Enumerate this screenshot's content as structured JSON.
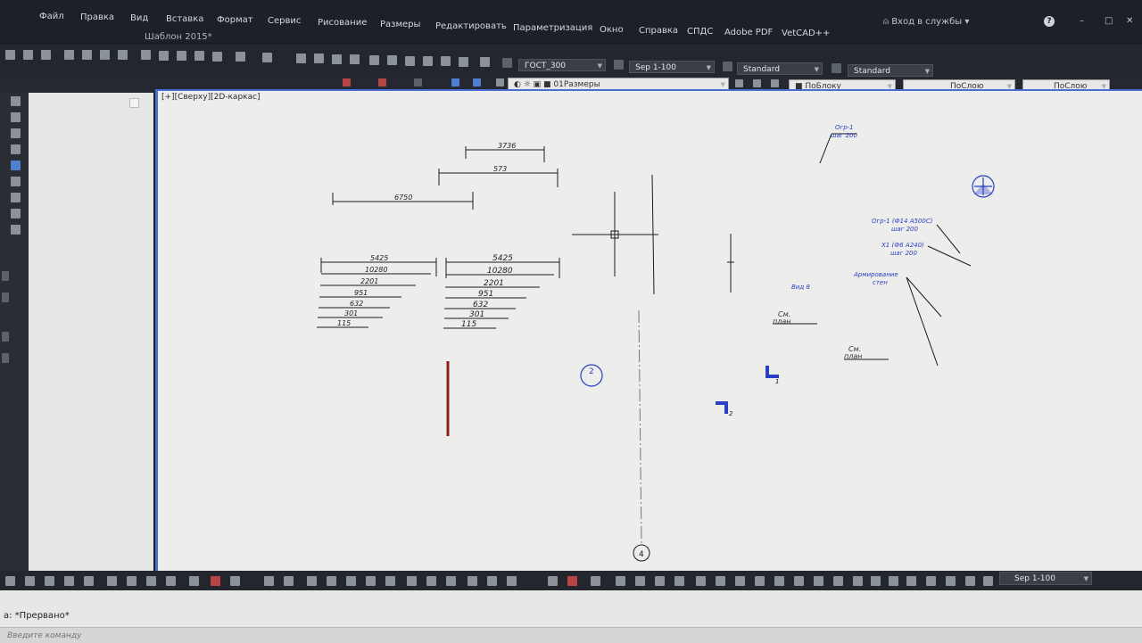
{
  "menu": [
    "Файл",
    "Правка",
    "Вид",
    "Вставка",
    "Формат",
    "Сервис",
    "Рисование",
    "Размеры",
    "Редактировать",
    "Параметризация",
    "Окно",
    "Справка",
    "СПДС",
    "Adobe PDF",
    "VetCAD++"
  ],
  "document_title": "Шаблон 2015*",
  "signin_label": "Вход в службы",
  "toolbar": {
    "text_style": "ГОСТ_300",
    "dim_scale": "Sep 1-100",
    "table_style": "Standard",
    "multileader_style": "Standard",
    "layer": "01Размеры",
    "color": "ПоБлоку",
    "linetype": "ПоСлою",
    "lineweight": "ПоСлою"
  },
  "viewport_label": "[+][Сверху][2D-каркас]",
  "drawing": {
    "dim_top": [
      "3736",
      "573",
      "6750"
    ],
    "dim_stack_left": [
      "5425",
      "10280",
      "2201",
      "951",
      "632",
      "301",
      "115"
    ],
    "dim_stack_right": [
      "5425",
      "10280",
      "2201",
      "951",
      "632",
      "301",
      "115"
    ],
    "annot_1": [
      "Огр-1",
      "шаг 200"
    ],
    "annot_2": [
      "Огр-1 (Ф14 А500С)",
      "шаг 200"
    ],
    "annot_3": [
      "Х1 (Ф6 А240)",
      "шаг 200"
    ],
    "annot_4": [
      "Армирование",
      "стен"
    ],
    "annot_5": "Вид 8",
    "annot_see_plan_1": [
      "См.",
      "план"
    ],
    "annot_see_plan_2": [
      "См.",
      "план"
    ],
    "axis_marker": "4",
    "section_marker": "2",
    "cut_1": "1",
    "cut_2": "2"
  },
  "bottom_scale": "Sep 1-100",
  "command": {
    "history": "а:  *Прервано*",
    "placeholder": "Введите команду"
  }
}
